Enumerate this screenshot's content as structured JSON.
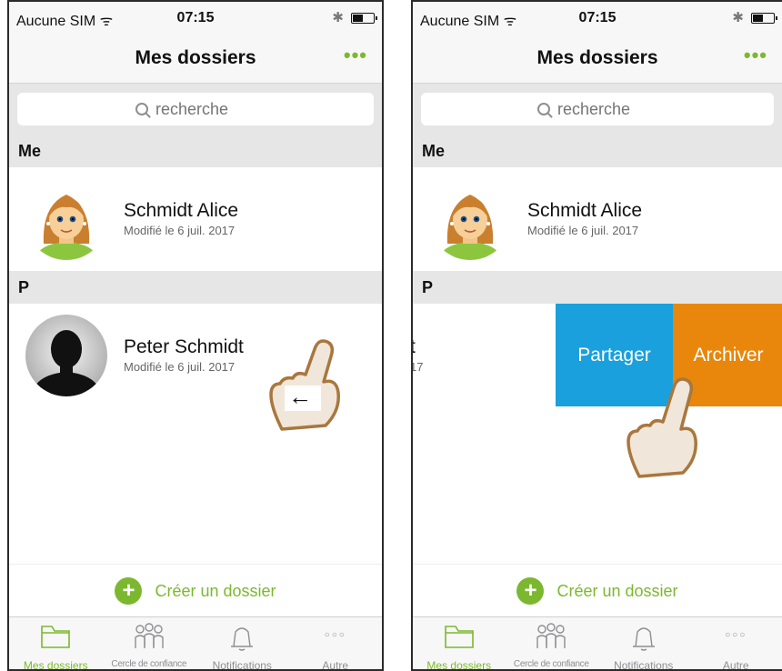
{
  "colors": {
    "accent": "#7cb82f",
    "share": "#1aa0dc",
    "archive": "#e8870b"
  },
  "status": {
    "carrier": "Aucune SIM ᯤ",
    "time": "07:15",
    "bluetooth": "✱",
    "battery_level": 0.5
  },
  "nav": {
    "title": "Mes dossiers",
    "more": "•••"
  },
  "search": {
    "placeholder": "recherche"
  },
  "sections": {
    "me": "Me",
    "p": "P"
  },
  "contacts": {
    "alice": {
      "name": "Schmidt Alice",
      "modified": "Modifié le 6 juil. 2017"
    },
    "peter": {
      "name": "Peter Schmidt",
      "modified": "Modifié le 6 juil. 2017"
    }
  },
  "swipe": {
    "name_fragment": "t",
    "sub_fragment": "17",
    "share_label": "Partager",
    "archive_label": "Archiver"
  },
  "gesture": {
    "arrow": "←"
  },
  "create_label": "Créer un dossier",
  "tabs": {
    "dossiers": "Mes dossiers",
    "cercle": "Cercle de confiance",
    "notifications": "Notifications",
    "autre": "Autre",
    "autre_icon": "○○○"
  },
  "icons": [
    "folder-icon",
    "people-group-icon",
    "bell-icon",
    "more-dots-icon",
    "search-icon",
    "plus-icon",
    "hand-pointer-icon"
  ]
}
